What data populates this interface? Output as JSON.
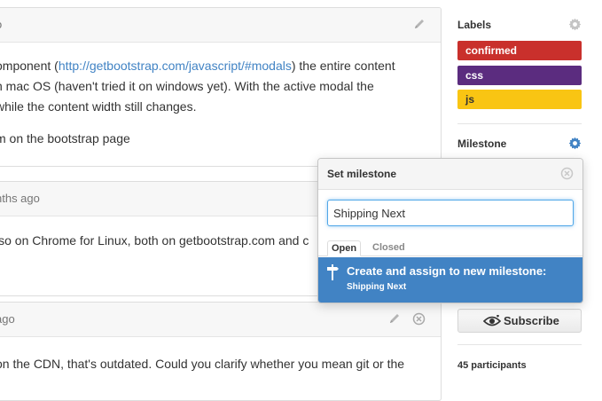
{
  "comments": [
    {
      "meta": "o",
      "lines": [
        [
          "omponent (",
          "http://getbootstrap.com/javascript/#modals",
          ") the entire content"
        ],
        [
          "n mac OS (haven't tried it on windows yet). With the active modal the"
        ],
        [
          "while the content width still changes."
        ],
        [
          "m on the bootstrap page"
        ]
      ]
    },
    {
      "meta": "nths ago",
      "lines": [
        [
          "lso on Chrome for Linux, both on getbootstrap.com and c"
        ]
      ]
    },
    {
      "meta": "ago",
      "lines": [
        [
          "on the CDN, that's outdated. Could you clarify whether you mean git or the"
        ]
      ]
    }
  ],
  "sidebar": {
    "labels_title": "Labels",
    "labels": [
      {
        "name": "confirmed",
        "bg": "#c9302c",
        "fg": "#ffffff"
      },
      {
        "name": "css",
        "bg": "#5b2c7f",
        "fg": "#ffffff"
      },
      {
        "name": "js",
        "bg": "#f9c513",
        "fg": "#333333"
      }
    ],
    "milestone_title": "Milestone",
    "subscribe_label": "Subscribe",
    "participants": "45 participants"
  },
  "popup": {
    "title": "Set milestone",
    "input_value": "Shipping Next",
    "tabs": [
      "Open",
      "Closed"
    ],
    "create_title": "Create and assign to new milestone:",
    "create_sub": "Shipping Next"
  },
  "icons": {
    "edit": "pencil-icon",
    "close": "close-icon",
    "settings": "gear-icon",
    "milestone": "milestone-icon",
    "subscribe": "eye-icon"
  },
  "colors": {
    "accent": "#4183c4",
    "gear_active": "#4183c4",
    "gear_inactive": "#c4c4c4"
  }
}
